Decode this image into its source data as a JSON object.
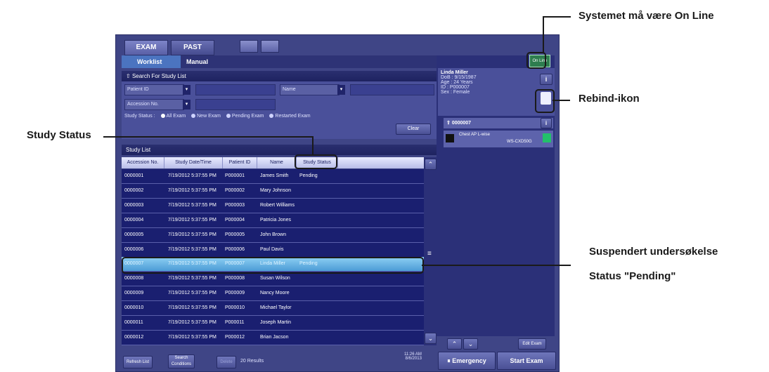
{
  "tabs": [
    "EXAM",
    "PAST"
  ],
  "subtabs": [
    "Worklist",
    "Manual"
  ],
  "search": {
    "header": "Search For Study List",
    "patient_id_label": "Patient ID",
    "name_label": "Name",
    "accession_label": "Accession No.",
    "status_label": "Study Status :",
    "status_options": [
      "All Exam",
      "New Exam",
      "Pending Exam",
      "Restarted Exam"
    ],
    "clear": "Clear"
  },
  "study_list": {
    "header": "Study List",
    "columns": [
      "Accession No.",
      "Study Date/Time",
      "Patient ID",
      "Name",
      "Study Status"
    ],
    "rows": [
      [
        "0000001",
        "7/19/2012 5:37:55 PM",
        "P000001",
        "James Smith",
        "Pending"
      ],
      [
        "0000002",
        "7/19/2012 5:37:55 PM",
        "P000002",
        "Mary Johnson",
        ""
      ],
      [
        "0000003",
        "7/19/2012 5:37:55 PM",
        "P000003",
        "Robert Williams",
        ""
      ],
      [
        "0000004",
        "7/19/2012 5:37:55 PM",
        "P000004",
        "Patricia Jones",
        ""
      ],
      [
        "0000005",
        "7/19/2012 5:37:55 PM",
        "P000005",
        "John Brown",
        ""
      ],
      [
        "0000006",
        "7/19/2012 5:37:55 PM",
        "P000006",
        "Paul Davis",
        ""
      ],
      [
        "0000007",
        "7/19/2012 5:37:55 PM",
        "P000007",
        "Linda Miller",
        "Pending"
      ],
      [
        "0000008",
        "7/19/2012 5:37:55 PM",
        "P000008",
        "Susan Wilson",
        ""
      ],
      [
        "0000009",
        "7/19/2012 5:37:55 PM",
        "P000009",
        "Nancy Moore",
        ""
      ],
      [
        "0000010",
        "7/19/2012 5:37:55 PM",
        "P000010",
        "Michael Taylor",
        ""
      ],
      [
        "0000011",
        "7/19/2012 5:37:55 PM",
        "P000011",
        "Joseph Martin",
        ""
      ],
      [
        "0000012",
        "7/19/2012 5:37:55 PM",
        "P000012",
        "Brian Jacson",
        ""
      ]
    ]
  },
  "bottom": {
    "refresh": "Refresh List",
    "search_conditions": "Search Conditions",
    "delete": "Delete",
    "results": "20 Results",
    "time": "11:26 AM",
    "date": "8/6/2013"
  },
  "patient": {
    "name": "Linda Miller",
    "dob": "DoB : 9/15/1987",
    "age": "Age : 24 Years",
    "id": "ID : P000007",
    "sex": "Sex : Female",
    "info": "i"
  },
  "online": "On Line",
  "exam": {
    "accession": "0000007",
    "item": "Chest AP L-wise",
    "detector": "WS-CXD50G"
  },
  "right_buttons": {
    "edit": "Edit Exam",
    "emergency": "Emergency",
    "start": "Start Exam"
  },
  "annotations": {
    "online": "Systemet må være On Line",
    "rebind": "Rebind-ikon",
    "study_status": "Study Status",
    "suspended": "Suspendert undersøkelse",
    "pending": "Status \"Pending\""
  },
  "colors": {
    "frame": "#3f4586",
    "row": "#1a1f70",
    "selected": "#4c9cd6",
    "online": "#2e7d4f"
  }
}
